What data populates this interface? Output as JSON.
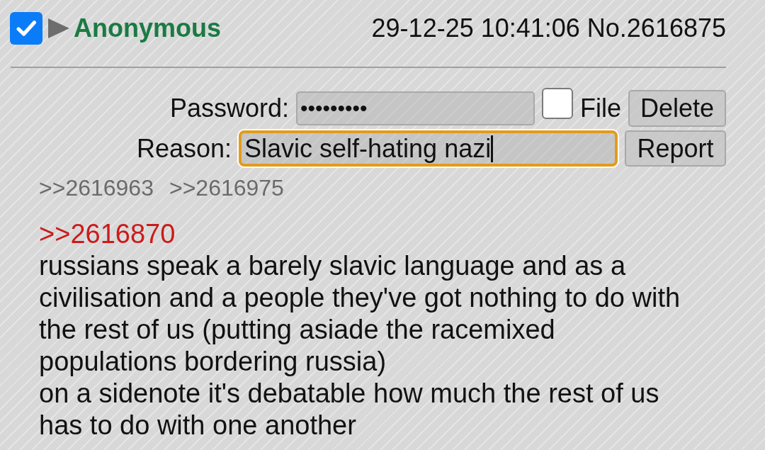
{
  "post_header": {
    "select_checkbox": {
      "checked": true
    },
    "name": "Anonymous",
    "datetime": "29-12-25 10:41:06",
    "number": "No.2616875"
  },
  "delete_form": {
    "password": {
      "label": "Password:",
      "value": "•••••••••"
    },
    "file_only": {
      "label": "File",
      "checked": false
    },
    "delete_button": "Delete",
    "reason": {
      "label": "Reason:",
      "value": "Slavic self-hating nazi",
      "focused": true
    },
    "report_button": "Report"
  },
  "backlinks": [
    ">>2616963",
    ">>2616975"
  ],
  "post_body": {
    "quote_link": ">>2616870",
    "lines": [
      "russians speak a barely slavic language and as a",
      "civilisation and a people they've got nothing to do with",
      "the rest of us (putting asiade the racemixed",
      "populations bordering russia)",
      "on a sidenote it's debatable how much the rest of us",
      "has to do with one another"
    ]
  }
}
